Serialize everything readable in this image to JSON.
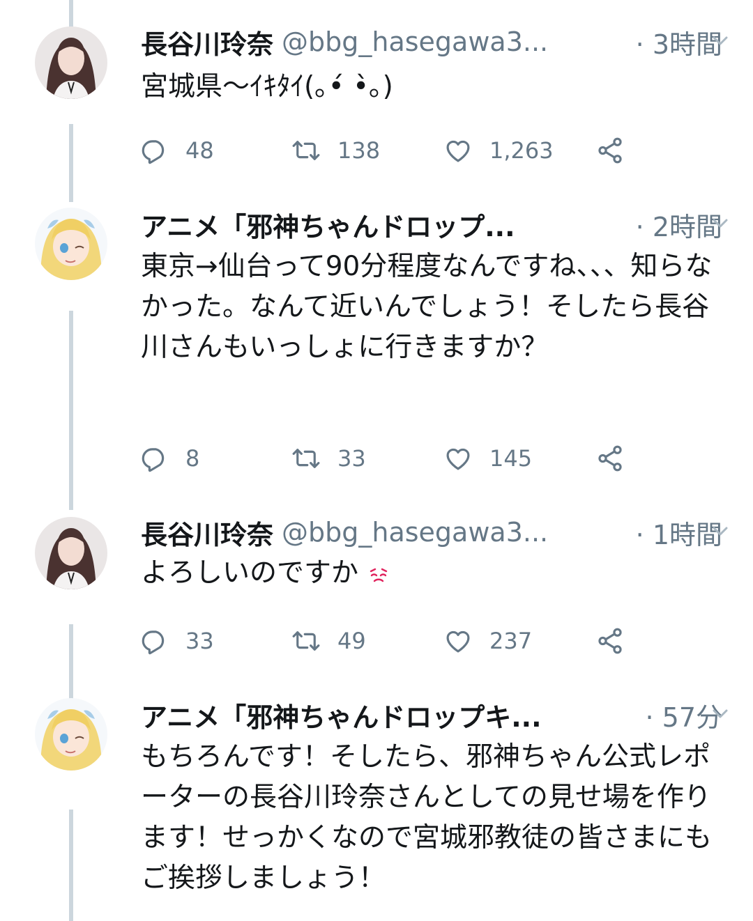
{
  "tweets": [
    {
      "name": "長谷川玲奈",
      "handle": "@bbg_hasegawa3...",
      "time": "· 3時間",
      "text": "宮城県〜ｲｷﾀｲ(｡•́ •̀｡)",
      "replies": "48",
      "retweets": "138",
      "likes": "1,263",
      "avatar": "person-photo"
    },
    {
      "name": "アニメ「邪神ちゃんドロップ...",
      "handle": "",
      "time": "· 2時間",
      "text": "東京→仙台って90分程度なんですね、、、知らなかった。なんて近いんでしょう！そしたら長谷川さんもいっしょに行きますか？",
      "replies": "8",
      "retweets": "33",
      "likes": "145",
      "avatar": "anime-character"
    },
    {
      "name": "長谷川玲奈",
      "handle": "@bbg_hasegawa3...",
      "time": "· 1時間",
      "text": "よろしいのですか",
      "replies": "33",
      "retweets": "49",
      "likes": "237",
      "avatar": "person-photo",
      "emoji": "pleading-face-emoji"
    },
    {
      "name": "アニメ「邪神ちゃんドロップキ...",
      "handle": "",
      "time": "· 57分",
      "text": "もちろんです！そしたら、邪神ちゃん公式レポーターの長谷川玲奈さんとしての見せ場を作ります！せっかくなので宮城邪教徒の皆さまにもご挨拶しましょう！",
      "avatar": "anime-character"
    }
  ],
  "colors": {
    "text": "#14171a",
    "secondary": "#657786",
    "thread_line": "#ccd6dd",
    "emoji_red": "#e0245e"
  }
}
